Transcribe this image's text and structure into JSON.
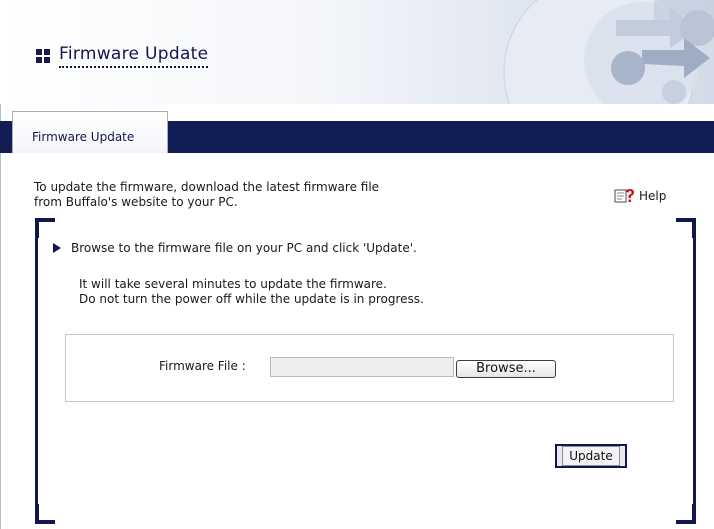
{
  "header": {
    "title": "Firmware Update"
  },
  "tabs": [
    {
      "label": "Firmware Update",
      "active": true
    }
  ],
  "intro": {
    "line1": "To update the firmware, download the latest firmware file",
    "line2": "from Buffalo's website to your PC."
  },
  "help": {
    "label": "Help",
    "icon": "help-icon"
  },
  "instructions": {
    "step": "Browse to the firmware file on your PC and click 'Update'.",
    "note1": "It will take several minutes to update the firmware.",
    "note2": "Do not turn the power off while the update is in progress."
  },
  "form": {
    "file_label": "Firmware File :",
    "file_value": "",
    "browse_label": "Browse...",
    "update_label": "Update"
  },
  "colors": {
    "navy": "#121c55",
    "accent": "#121650"
  }
}
